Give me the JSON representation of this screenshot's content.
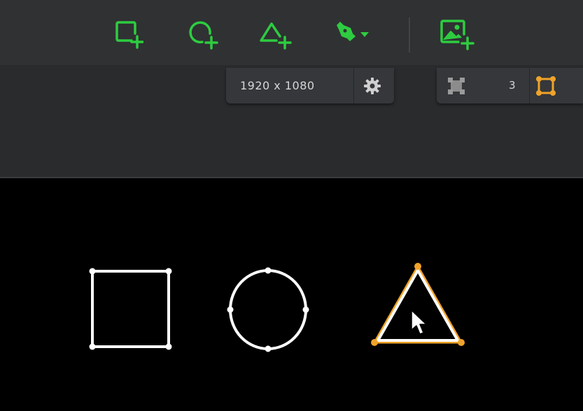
{
  "app": {
    "colors": {
      "toolbar_bg": "#303133",
      "tool_accent": "#2ecc40",
      "selection": "#f0a32a",
      "shape_stroke": "#ffffff",
      "canvas_bg": "#000000"
    }
  },
  "toolbar": {
    "tools": [
      {
        "name": "add-rectangle-icon"
      },
      {
        "name": "add-circle-icon"
      },
      {
        "name": "add-triangle-icon"
      },
      {
        "name": "pen-tool-icon"
      },
      {
        "name": "chevron-down-icon"
      },
      {
        "name": "add-image-icon"
      }
    ]
  },
  "status": {
    "resolution": "1920 x 1080",
    "settings_icon": "gear-icon",
    "points_count": "3"
  },
  "canvas": {
    "shapes": [
      {
        "name": "square-shape",
        "selected": false
      },
      {
        "name": "circle-shape",
        "selected": false
      },
      {
        "name": "triangle-shape",
        "selected": true
      }
    ]
  }
}
